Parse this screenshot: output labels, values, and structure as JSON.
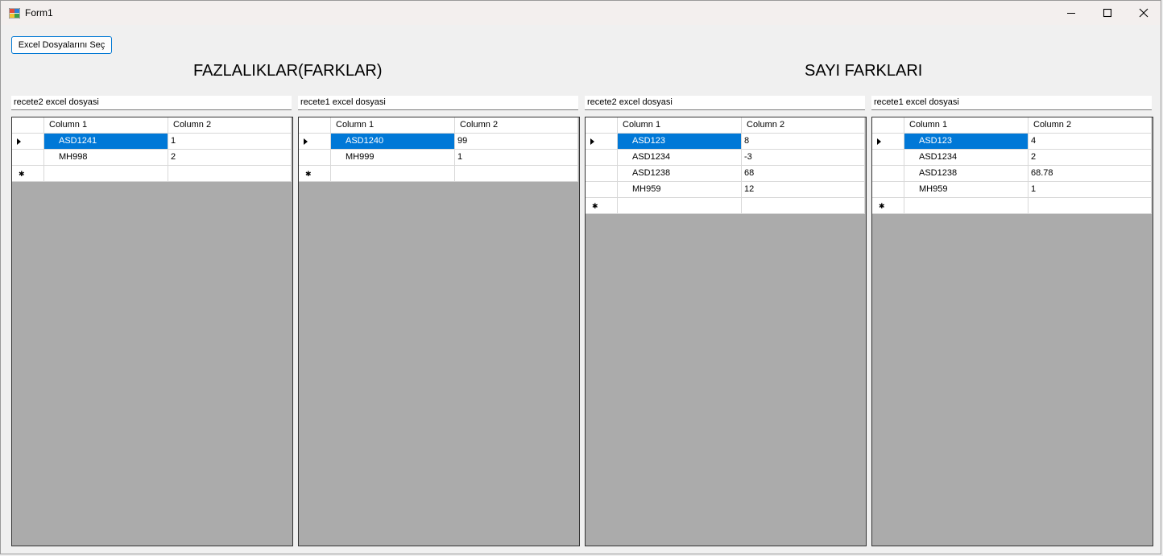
{
  "window": {
    "title": "Form1"
  },
  "toolbar": {
    "select_button": "Excel Dosyalarını Seç"
  },
  "headings": {
    "left": "FAZLALIKLAR(FARKLAR)",
    "right": "SAYI FARKLARI"
  },
  "panels": [
    {
      "label": "recete2 excel dosyasi",
      "columns": [
        "Column 1",
        "Column 2"
      ],
      "rows": [
        [
          "ASD1241",
          "1"
        ],
        [
          "MH998",
          "2"
        ]
      ]
    },
    {
      "label": "recete1 excel dosyasi",
      "columns": [
        "Column 1",
        "Column 2"
      ],
      "rows": [
        [
          "ASD1240",
          "99"
        ],
        [
          "MH999",
          "1"
        ]
      ]
    },
    {
      "label": "recete2 excel dosyasi",
      "columns": [
        "Column 1",
        "Column 2"
      ],
      "rows": [
        [
          "ASD123",
          "8"
        ],
        [
          "ASD1234",
          "-3"
        ],
        [
          "ASD1238",
          "68"
        ],
        [
          "MH959",
          "12"
        ]
      ]
    },
    {
      "label": "recete1 excel dosyasi",
      "columns": [
        "Column 1",
        "Column 2"
      ],
      "rows": [
        [
          "ASD123",
          "4"
        ],
        [
          "ASD1234",
          "2"
        ],
        [
          "ASD1238",
          "68.78"
        ],
        [
          "MH959",
          "1"
        ]
      ]
    }
  ],
  "new_row_glyph": "✱",
  "colors": {
    "selection": "#0078d7",
    "grid_background": "#ababab",
    "accent": "#0078d4"
  }
}
